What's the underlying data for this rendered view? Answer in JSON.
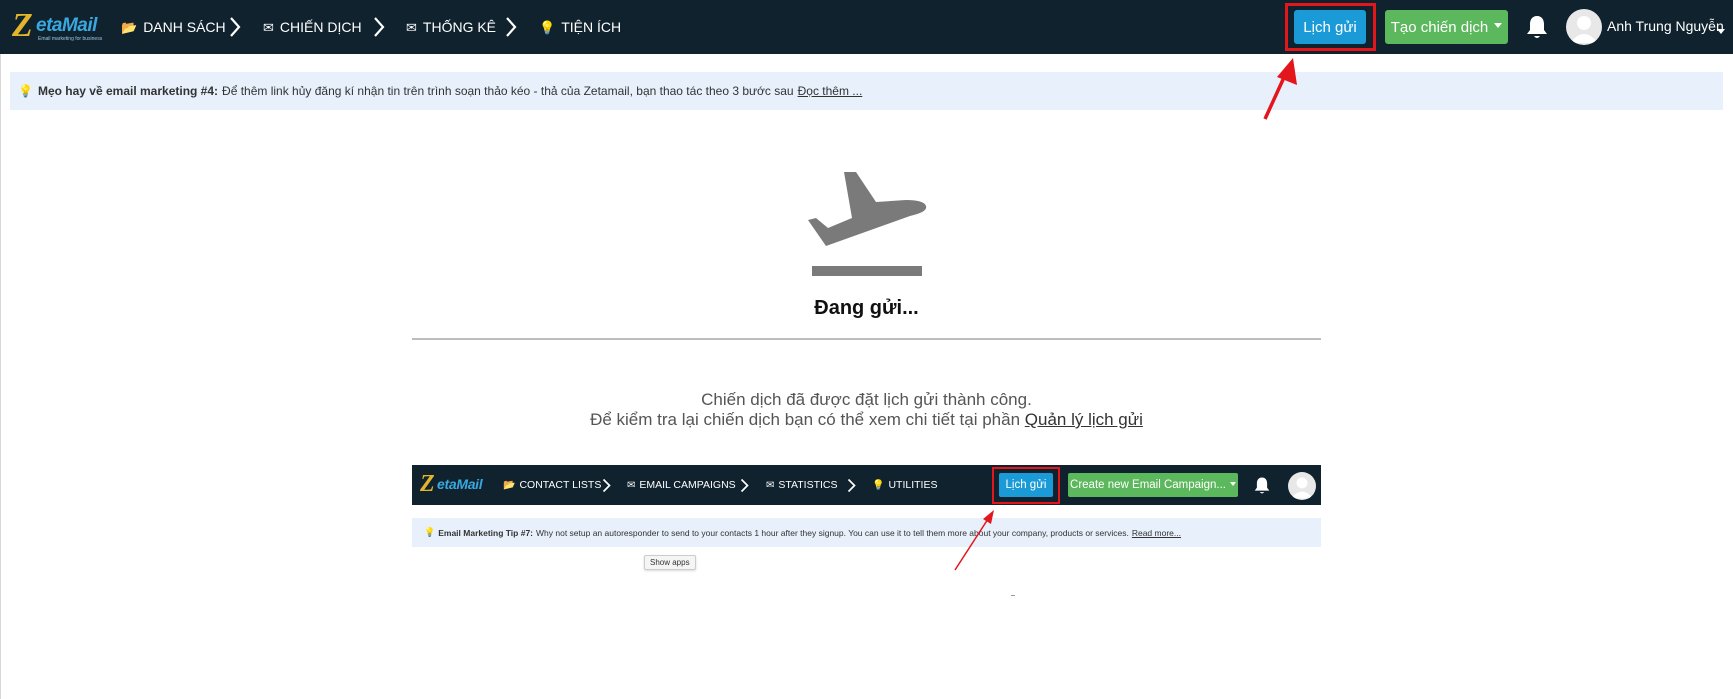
{
  "topbar": {
    "logo": {
      "letter": "Z",
      "name": "etaMail",
      "tagline": "Email marketing for business"
    },
    "nav": [
      {
        "icon": "📂",
        "label": "DANH SÁCH"
      },
      {
        "icon": "✉",
        "label": "CHIẾN DỊCH"
      },
      {
        "icon": "✉",
        "label": "THỐNG KÊ"
      },
      {
        "icon": "💡",
        "label": "TIỆN ÍCH"
      }
    ],
    "schedule_button": "Lịch gửi",
    "create_button": "Tạo chiến dịch",
    "user_name": "Anh Trung Nguyễn"
  },
  "tip": {
    "icon": "💡",
    "title": "Mẹo hay về email marketing #4:",
    "text": "Để thêm link hủy đăng kí nhận tin trên trình soạn thảo kéo - thả của Zetamail, bạn thao tác theo 3 bước sau",
    "link": "Đọc thêm ..."
  },
  "main": {
    "status_icon": "airplane-departure-icon",
    "heading": "Đang gửi...",
    "message_line1": "Chiến dịch đã được đặt lịch gửi thành công.",
    "message_line2": "Để kiểm tra lại chiến dịch bạn có thể xem chi tiết tại phần",
    "message_link": "Quản lý lịch gửi"
  },
  "embedded": {
    "logo": {
      "letter": "Z",
      "name": "etaMail"
    },
    "nav": [
      {
        "icon": "📂",
        "label": "CONTACT LISTS"
      },
      {
        "icon": "✉",
        "label": "EMAIL CAMPAIGNS"
      },
      {
        "icon": "✉",
        "label": "STATISTICS"
      },
      {
        "icon": "💡",
        "label": "UTILITIES"
      }
    ],
    "schedule_button": "Lịch gửi",
    "create_button": "Create new Email Campaign...",
    "tip": {
      "icon": "💡",
      "title": "Email Marketing Tip #7:",
      "text": "Why not setup an autoresponder to send to your contacts 1 hour after they signup. You can use it to tell them more about your company, products or services.",
      "link": "Read more..."
    },
    "tooltip": "Show apps"
  },
  "colors": {
    "navbar": "#10222e",
    "primary": "#1a9bd7",
    "success": "#5cb85c",
    "highlight": "#e3161b",
    "tip_background": "#e7f0fb"
  }
}
